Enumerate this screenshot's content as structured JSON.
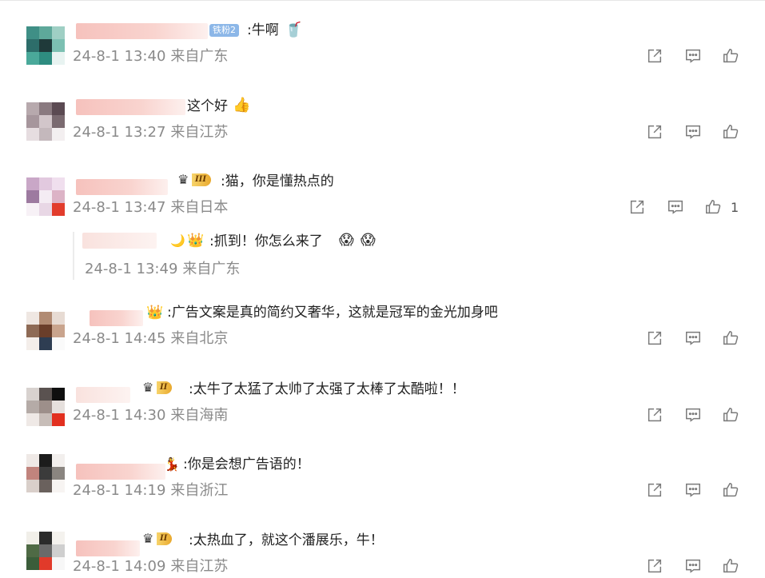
{
  "comments": [
    {
      "text": ":牛啊",
      "badge": "铁粉2",
      "date": "24-8-1 13:40",
      "location": "来自广东",
      "likes": ""
    },
    {
      "text": "这个好",
      "date": "24-8-1 13:27",
      "location": "来自江苏",
      "likes": ""
    },
    {
      "text": ":猫，你是懂热点的",
      "rank": "III",
      "date": "24-8-1 13:47",
      "location": "来自日本",
      "likes": "1"
    },
    {
      "text": ":抓到！你怎么来了",
      "date": "24-8-1 13:49",
      "location": "来自广东",
      "likes": ""
    },
    {
      "text": ":广告文案是真的简约又奢华，这就是冠军的金光加身吧",
      "date": "24-8-1 14:45",
      "location": "来自北京",
      "likes": ""
    },
    {
      "text": ":太牛了太猛了太帅了太强了太棒了太酷啦！！",
      "rank": "II",
      "date": "24-8-1 14:30",
      "location": "来自海南",
      "likes": ""
    },
    {
      "text": ":你是会想广告语的！",
      "date": "24-8-1 14:19",
      "location": "来自浙江",
      "likes": ""
    },
    {
      "text": ":太热血了，就这个潘展乐，牛！",
      "rank": "II",
      "date": "24-8-1 14:09",
      "location": "来自江苏",
      "likes": ""
    }
  ],
  "icons": {
    "share": "share-icon",
    "comment": "comment-icon",
    "like": "thumbs-up-icon"
  },
  "colors": {
    "meta_text": "#8a8a8a",
    "icon": "#7a7a7a",
    "badge": "#8cb7e8",
    "rank_gold": "#e9a92e"
  }
}
